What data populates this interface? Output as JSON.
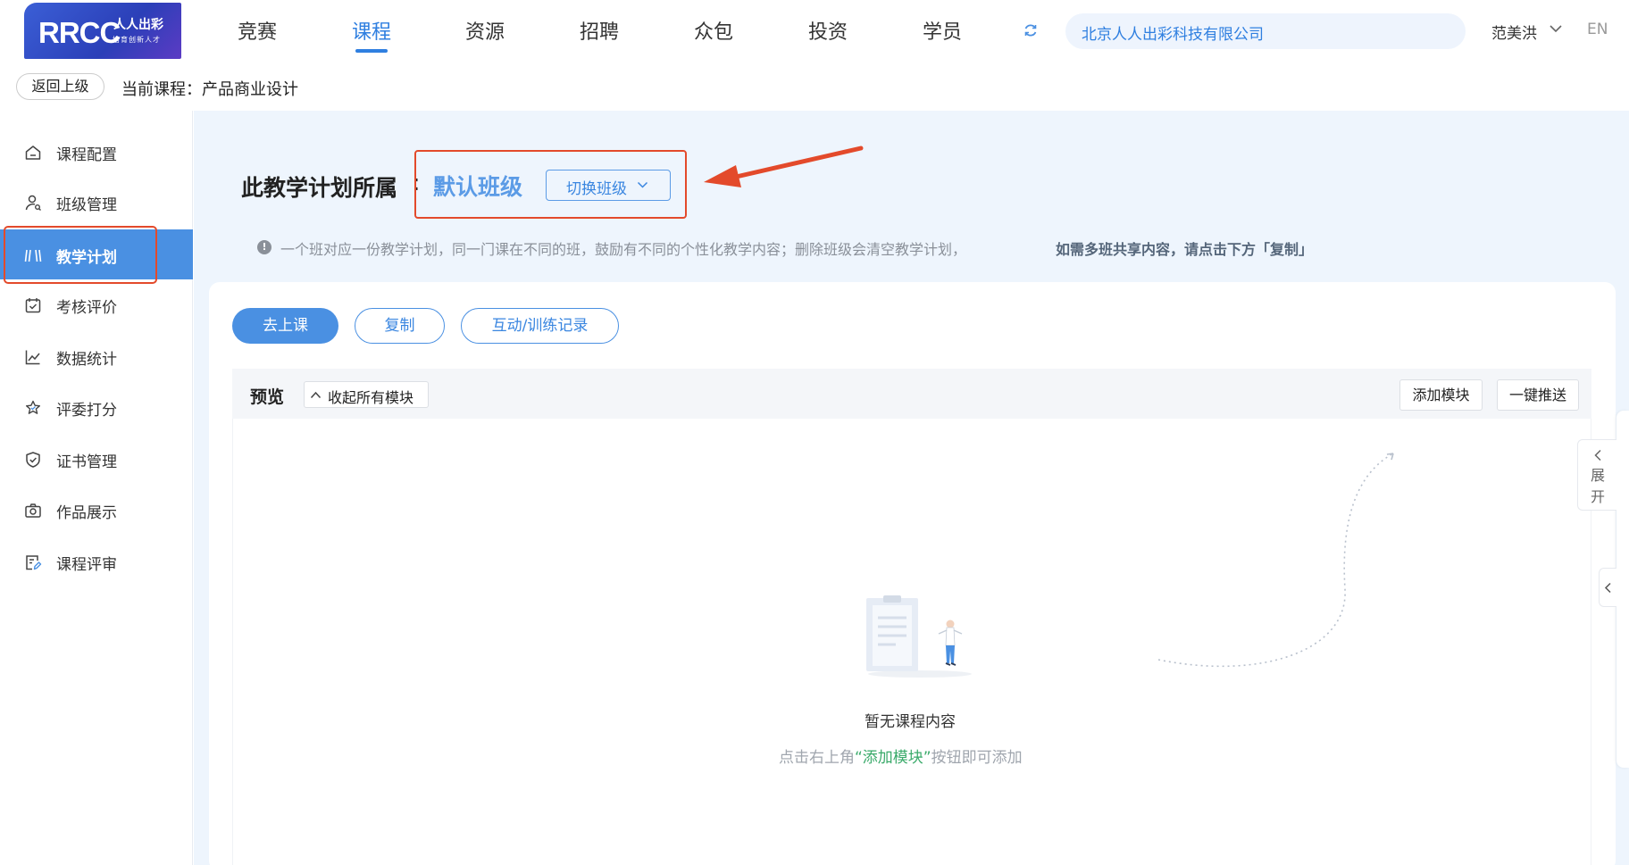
{
  "logo": {
    "mark": "RRCC",
    "cn_name": "人人出彩",
    "slogan": "培育创新人才"
  },
  "nav": {
    "items": [
      {
        "label": "竞赛"
      },
      {
        "label": "课程"
      },
      {
        "label": "资源"
      },
      {
        "label": "招聘"
      },
      {
        "label": "众包"
      },
      {
        "label": "投资"
      },
      {
        "label": "学员"
      }
    ],
    "active_index": 1,
    "company": "北京人人出彩科技有限公司",
    "user": "范美洪",
    "lang": "EN"
  },
  "course_bar": {
    "back_label": "返回上级",
    "current_course": "当前课程：产品商业设计"
  },
  "sidebar": {
    "items": [
      {
        "label": "课程配置",
        "icon": "home-icon"
      },
      {
        "label": "班级管理",
        "icon": "user-search-icon"
      },
      {
        "label": "教学计划",
        "icon": "plan-icon"
      },
      {
        "label": "考核评价",
        "icon": "calendar-check-icon"
      },
      {
        "label": "数据统计",
        "icon": "line-chart-icon"
      },
      {
        "label": "评委打分",
        "icon": "star-icon"
      },
      {
        "label": "证书管理",
        "icon": "shield-check-icon"
      },
      {
        "label": "作品展示",
        "icon": "camera-icon"
      },
      {
        "label": "课程评审",
        "icon": "review-icon"
      }
    ],
    "active_index": 2
  },
  "plan": {
    "title": "此教学计划所属",
    "colon": ":",
    "class_name": "默认班级",
    "switch_label": "切换班级",
    "notice": "一个班对应一份教学计划，同一门课在不同的班，鼓励有不同的个性化教学内容；删除班级会清空教学计划，",
    "notice_bold": "如需多班共享内容，请点击下方「复制」"
  },
  "actions": {
    "go": "去上课",
    "copy": "复制",
    "record": "互动/训练记录"
  },
  "preview": {
    "title": "预览",
    "collapse_label": "收起所有模块",
    "add_module": "添加模块",
    "push": "一键推送"
  },
  "empty": {
    "title": "暂无课程内容",
    "hint_pre": "点击右上角",
    "hint_hl": "“添加模块”",
    "hint_post": "按钮即可添加"
  },
  "expand": {
    "chars": [
      "展",
      "开"
    ]
  },
  "colors": {
    "accent": "#4a90e2",
    "highlight_border": "#e34a2b",
    "hint_green": "#3aaa6a"
  }
}
